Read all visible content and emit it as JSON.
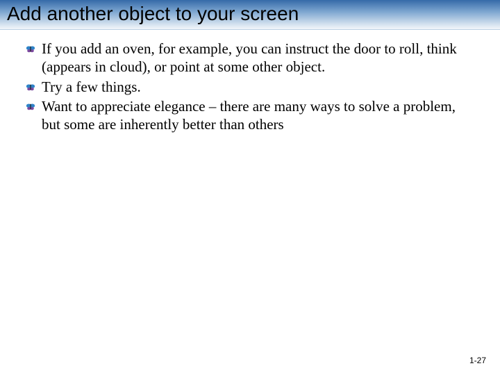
{
  "slide": {
    "title": "Add another object to your screen",
    "bullets": [
      "If you add an oven, for example, you can instruct the door to roll, think (appears in cloud),  or point at some other object.",
      "Try a few things.",
      "Want to appreciate elegance – there are many ways to solve a problem, but some are inherently better than others"
    ],
    "page_number": "1-27"
  }
}
